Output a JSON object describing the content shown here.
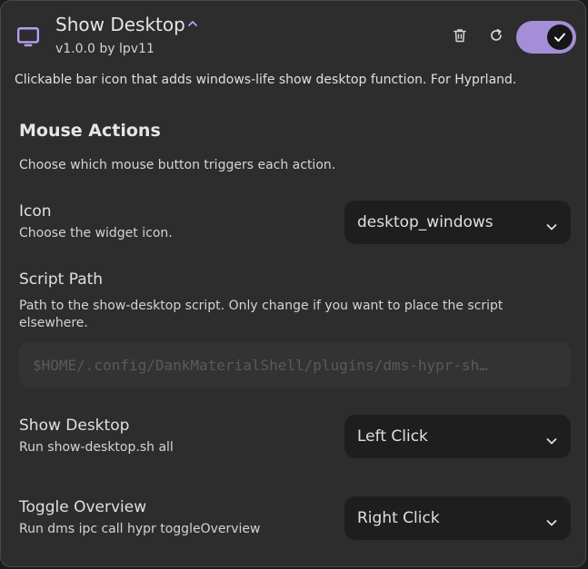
{
  "plugin": {
    "name": "Show Desktop",
    "version_line": "v1.0.0 by lpv11",
    "description": "Clickable bar icon that adds windows-life show desktop function. For Hyprland.",
    "enabled": true,
    "icon": "monitor-icon"
  },
  "header_actions": {
    "delete_icon": "trash-icon",
    "reload_icon": "reload-icon",
    "accent_color": "#a48ed8"
  },
  "mouse_actions": {
    "title": "Mouse Actions",
    "subtitle": "Choose which mouse button triggers each action."
  },
  "settings": {
    "icon": {
      "label": "Icon",
      "description": "Choose the widget icon.",
      "value": "desktop_windows"
    },
    "script_path": {
      "label": "Script Path",
      "description": "Path to the show-desktop script. Only change if you want to place the script elsewhere.",
      "placeholder": "$HOME/.config/DankMaterialShell/plugins/dms-hypr-sh…"
    },
    "show_desktop": {
      "label": "Show Desktop",
      "description": "Run show-desktop.sh all",
      "value": "Left Click"
    },
    "toggle_overview": {
      "label": "Toggle Overview",
      "description": "Run dms ipc call hypr toggleOverview",
      "value": "Right Click"
    }
  }
}
